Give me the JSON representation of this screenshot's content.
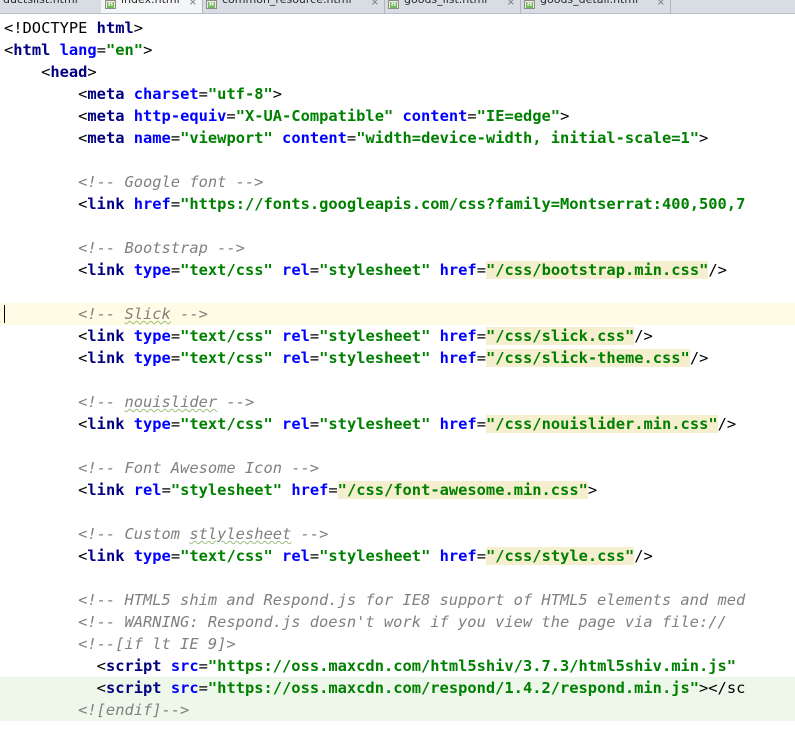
{
  "tabs": [
    {
      "label": "ductslist.html",
      "active": false
    },
    {
      "label": "index.html",
      "active": true
    },
    {
      "label": "common_resource.html",
      "active": false
    },
    {
      "label": "goods_list.html",
      "active": false
    },
    {
      "label": "goods_detail.html",
      "active": false
    }
  ],
  "tab_close_glyph": "×",
  "file_icon_letter": "H",
  "editor": {
    "caret_line": 13,
    "lines": [
      [
        [
          "br",
          "<!DOCTYPE "
        ],
        [
          "tag",
          "html"
        ],
        [
          "br",
          ">"
        ]
      ],
      [
        [
          "br",
          "<"
        ],
        [
          "tag",
          "html "
        ],
        [
          "attr",
          "lang"
        ],
        [
          "eq",
          "="
        ],
        [
          "val",
          "\"en\""
        ],
        [
          "br",
          ">"
        ]
      ],
      [
        [
          "br",
          "    <"
        ],
        [
          "tag",
          "head"
        ],
        [
          "br",
          ">"
        ]
      ],
      [
        [
          "br",
          "        <"
        ],
        [
          "tag",
          "meta "
        ],
        [
          "attr",
          "charset"
        ],
        [
          "eq",
          "="
        ],
        [
          "val",
          "\"utf-8\""
        ],
        [
          "br",
          ">"
        ]
      ],
      [
        [
          "br",
          "        <"
        ],
        [
          "tag",
          "meta "
        ],
        [
          "attr",
          "http-equiv"
        ],
        [
          "eq",
          "="
        ],
        [
          "val",
          "\"X-UA-Compatible\" "
        ],
        [
          "attr",
          "content"
        ],
        [
          "eq",
          "="
        ],
        [
          "val",
          "\"IE=edge\""
        ],
        [
          "br",
          ">"
        ]
      ],
      [
        [
          "br",
          "        <"
        ],
        [
          "tag",
          "meta "
        ],
        [
          "attr",
          "name"
        ],
        [
          "eq",
          "="
        ],
        [
          "val",
          "\"viewport\" "
        ],
        [
          "attr",
          "content"
        ],
        [
          "eq",
          "="
        ],
        [
          "val",
          "\"width=device-width, initial-scale=1\""
        ],
        [
          "br",
          ">"
        ]
      ],
      [],
      [
        [
          "comment",
          "        <!-- Google font -->"
        ]
      ],
      [
        [
          "br",
          "        <"
        ],
        [
          "tag",
          "link "
        ],
        [
          "attr",
          "href"
        ],
        [
          "eq",
          "="
        ],
        [
          "val",
          "\"https://fonts.googleapis.com/css?family=Montserrat:400,500,7"
        ]
      ],
      [],
      [
        [
          "comment",
          "        <!-- Bootstrap -->"
        ]
      ],
      [
        [
          "br",
          "        <"
        ],
        [
          "tag",
          "link "
        ],
        [
          "attr",
          "type"
        ],
        [
          "eq",
          "="
        ],
        [
          "val",
          "\"text/css\" "
        ],
        [
          "attr",
          "rel"
        ],
        [
          "eq",
          "="
        ],
        [
          "val",
          "\"stylesheet\" "
        ],
        [
          "attr",
          "href"
        ],
        [
          "eq",
          "="
        ],
        [
          "valhl",
          "\"/css/bootstrap.min.css\""
        ],
        [
          "br",
          "/>"
        ]
      ],
      [],
      [
        [
          "comment",
          "        <!-- "
        ],
        [
          "commentsq",
          "Slick"
        ],
        [
          "comment",
          " -->"
        ]
      ],
      [
        [
          "br",
          "        <"
        ],
        [
          "tag",
          "link "
        ],
        [
          "attr",
          "type"
        ],
        [
          "eq",
          "="
        ],
        [
          "val",
          "\"text/css\" "
        ],
        [
          "attr",
          "rel"
        ],
        [
          "eq",
          "="
        ],
        [
          "val",
          "\"stylesheet\" "
        ],
        [
          "attr",
          "href"
        ],
        [
          "eq",
          "="
        ],
        [
          "valhl",
          "\"/css/slick.css\""
        ],
        [
          "br",
          "/>"
        ]
      ],
      [
        [
          "br",
          "        <"
        ],
        [
          "tag",
          "link "
        ],
        [
          "attr",
          "type"
        ],
        [
          "eq",
          "="
        ],
        [
          "val",
          "\"text/css\" "
        ],
        [
          "attr",
          "rel"
        ],
        [
          "eq",
          "="
        ],
        [
          "val",
          "\"stylesheet\" "
        ],
        [
          "attr",
          "href"
        ],
        [
          "eq",
          "="
        ],
        [
          "valhl",
          "\"/css/slick-theme.css\""
        ],
        [
          "br",
          "/>"
        ]
      ],
      [],
      [
        [
          "comment",
          "        <!-- "
        ],
        [
          "commentsq",
          "nouislider"
        ],
        [
          "comment",
          " -->"
        ]
      ],
      [
        [
          "br",
          "        <"
        ],
        [
          "tag",
          "link "
        ],
        [
          "attr",
          "type"
        ],
        [
          "eq",
          "="
        ],
        [
          "val",
          "\"text/css\" "
        ],
        [
          "attr",
          "rel"
        ],
        [
          "eq",
          "="
        ],
        [
          "val",
          "\"stylesheet\" "
        ],
        [
          "attr",
          "href"
        ],
        [
          "eq",
          "="
        ],
        [
          "valhl",
          "\"/css/nouislider.min.css\""
        ],
        [
          "br",
          "/>"
        ]
      ],
      [],
      [
        [
          "comment",
          "        <!-- Font Awesome Icon -->"
        ]
      ],
      [
        [
          "br",
          "        <"
        ],
        [
          "tag",
          "link "
        ],
        [
          "attr",
          "rel"
        ],
        [
          "eq",
          "="
        ],
        [
          "val",
          "\"stylesheet\" "
        ],
        [
          "attr",
          "href"
        ],
        [
          "eq",
          "="
        ],
        [
          "valhl",
          "\"/css/font-awesome.min.css\""
        ],
        [
          "br",
          ">"
        ]
      ],
      [],
      [
        [
          "comment",
          "        <!-- Custom "
        ],
        [
          "commentsq",
          "stlylesheet"
        ],
        [
          "comment",
          " -->"
        ]
      ],
      [
        [
          "br",
          "        <"
        ],
        [
          "tag",
          "link "
        ],
        [
          "attr",
          "type"
        ],
        [
          "eq",
          "="
        ],
        [
          "val",
          "\"text/css\" "
        ],
        [
          "attr",
          "rel"
        ],
        [
          "eq",
          "="
        ],
        [
          "val",
          "\"stylesheet\" "
        ],
        [
          "attr",
          "href"
        ],
        [
          "eq",
          "="
        ],
        [
          "valhl",
          "\"/css/style.css\""
        ],
        [
          "br",
          "/>"
        ]
      ],
      [],
      [
        [
          "comment",
          "        <!-- HTML5 shim and Respond.js for IE8 support of HTML5 elements and med"
        ]
      ],
      [
        [
          "comment",
          "        <!-- WARNING: Respond.js doesn't work if you view the page via file://"
        ]
      ],
      [
        [
          "comment",
          "        <!--[if lt IE 9]>"
        ]
      ],
      [
        [
          "br",
          "          <"
        ],
        [
          "tag",
          "script "
        ],
        [
          "attr",
          "src"
        ],
        [
          "eq",
          "="
        ],
        [
          "val",
          "\"https://oss.maxcdn.com/html5shiv/3.7.3/html5shiv.min.js\""
        ]
      ],
      [
        [
          "br",
          "          <"
        ],
        [
          "tag",
          "script "
        ],
        [
          "attr",
          "src"
        ],
        [
          "eq",
          "="
        ],
        [
          "val",
          "\"https://oss.maxcdn.com/respond/1.4.2/respond.min.js\""
        ],
        [
          "br",
          "></sc"
        ]
      ],
      [
        [
          "comment",
          "        <![endif]-->"
        ]
      ]
    ]
  }
}
